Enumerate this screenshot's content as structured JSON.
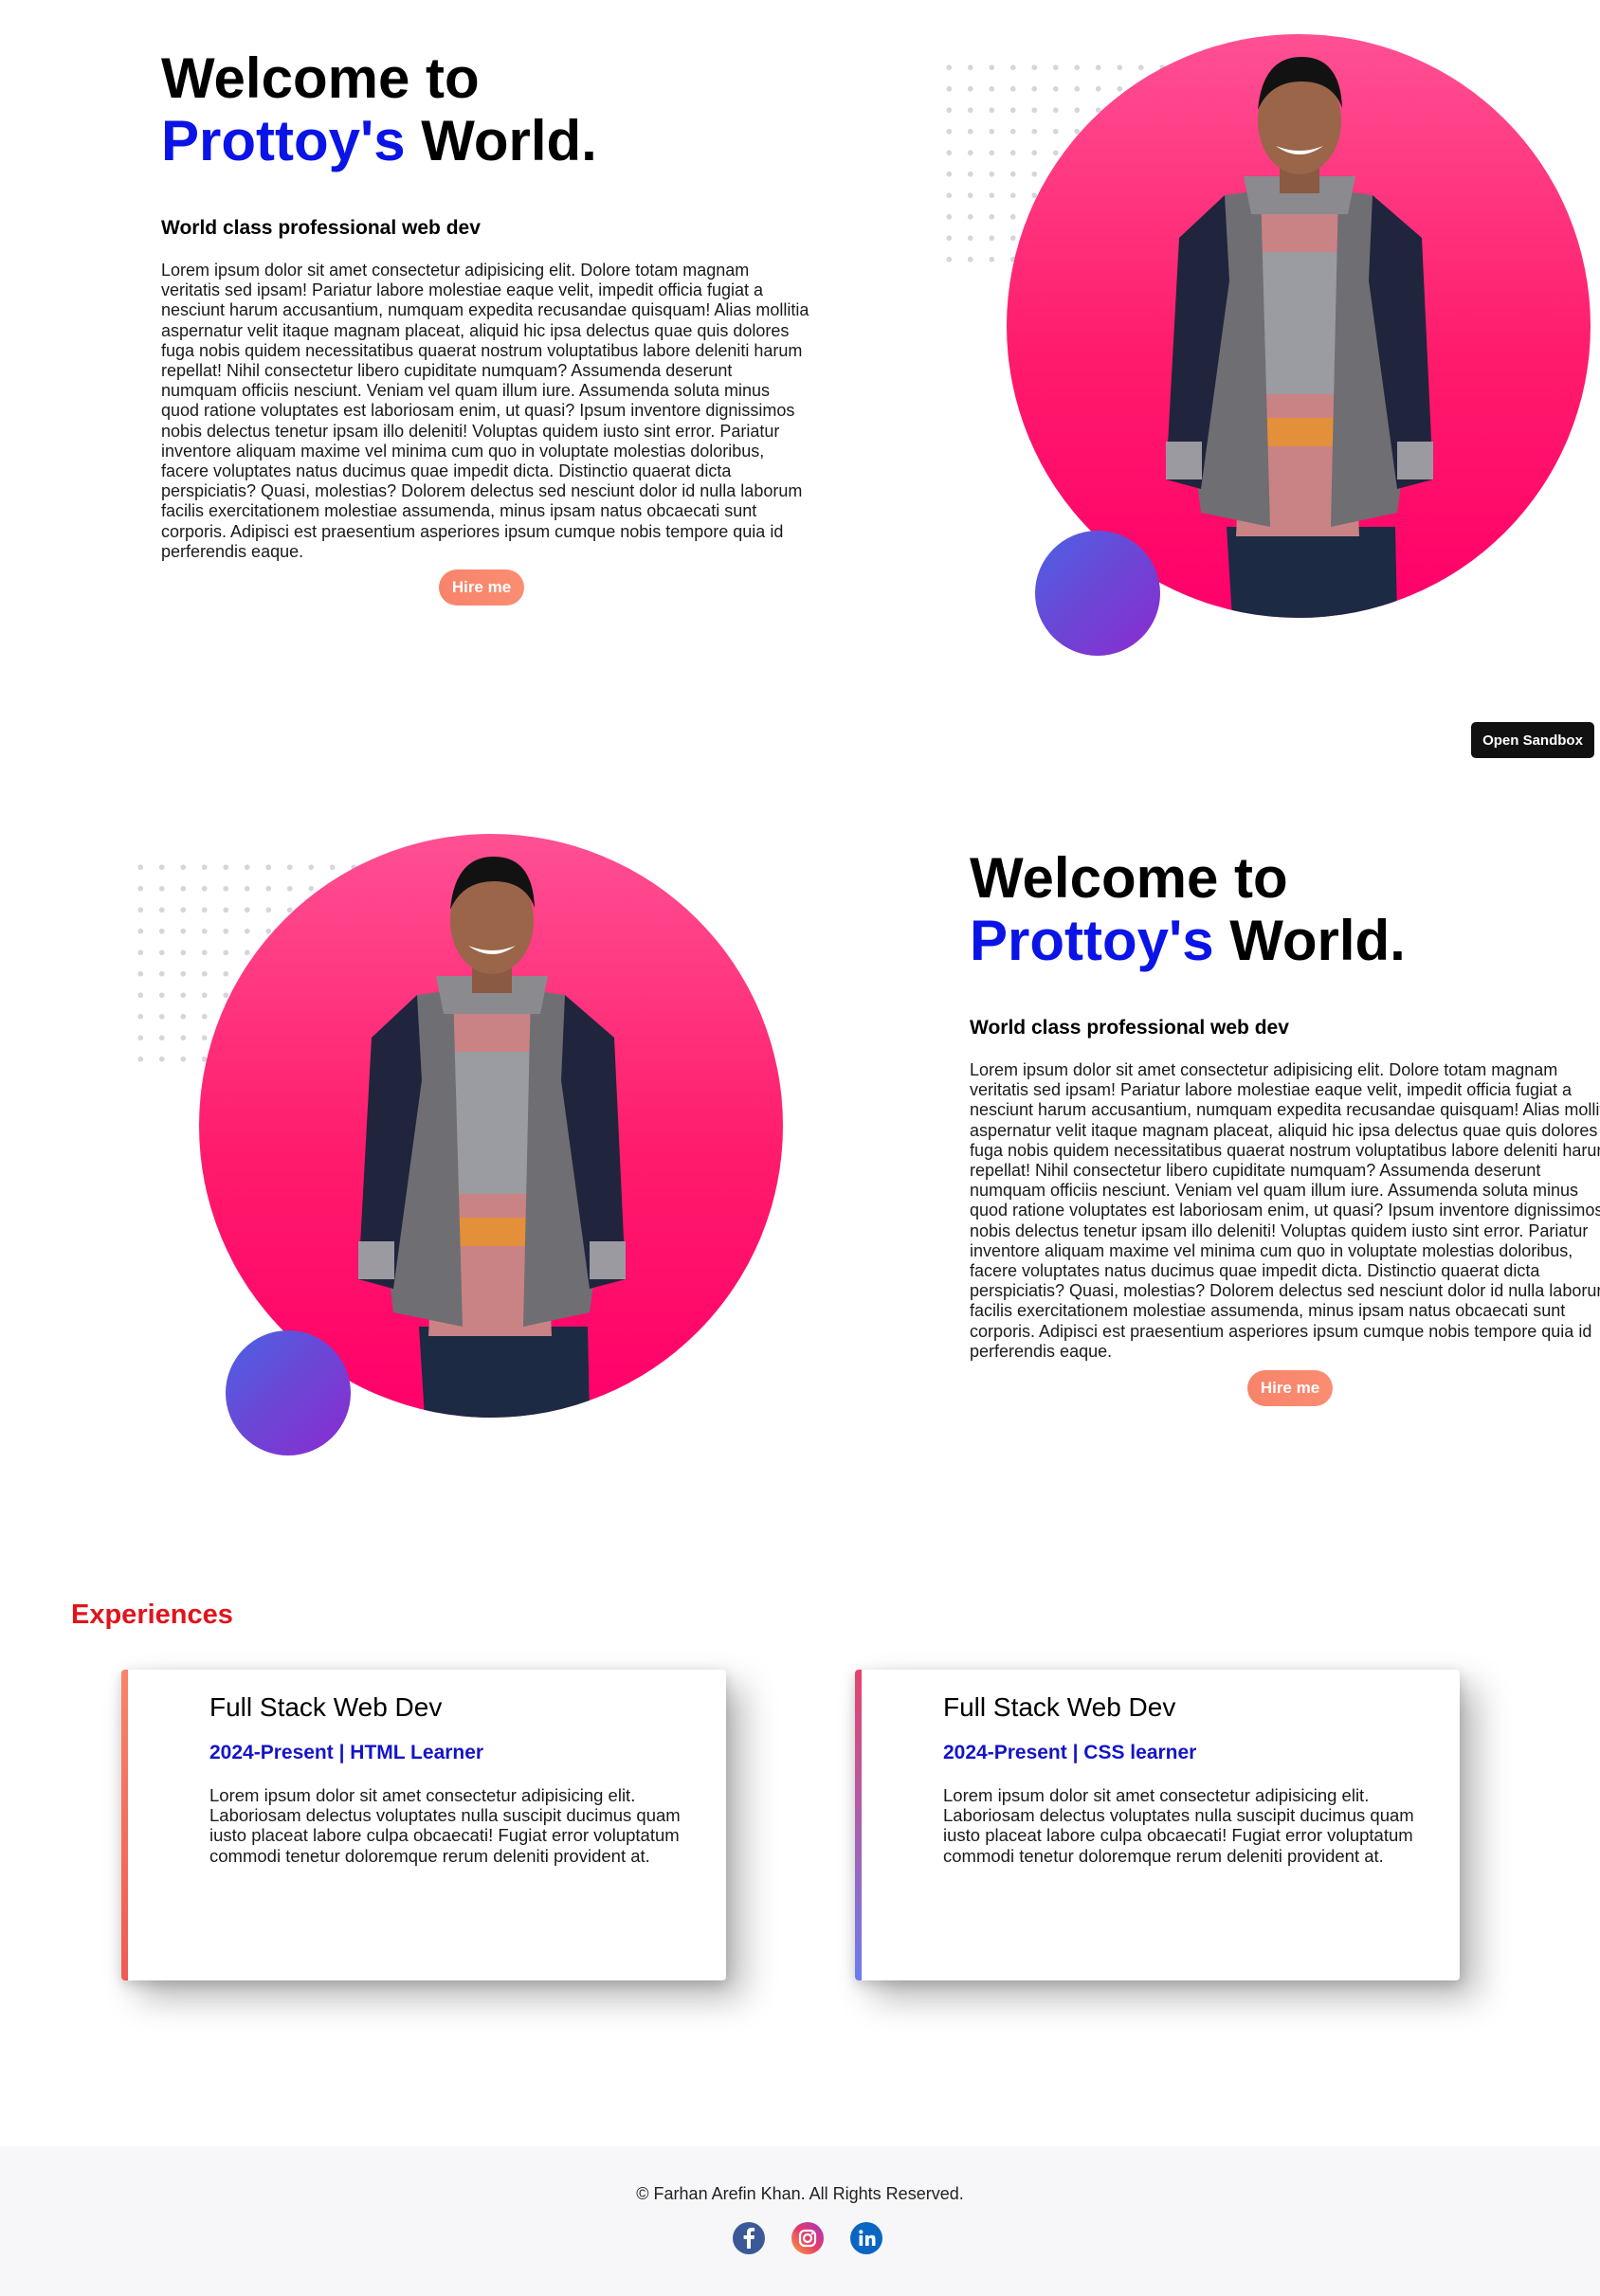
{
  "hero": {
    "title_line1": "Welcome to",
    "title_name": "Prottoy's",
    "title_rest": " World.",
    "subtitle": "World class professional web dev",
    "body": "Lorem ipsum dolor sit amet consectetur adipisicing elit. Dolore totam magnam veritatis sed ipsam! Pariatur labore molestiae eaque velit, impedit officia fugiat a nesciunt harum accusantium, numquam expedita recusandae quisquam! Alias mollitia aspernatur velit itaque magnam placeat, aliquid hic ipsa delectus quae quis dolores fuga nobis quidem necessitatibus quaerat nostrum voluptatibus labore deleniti harum repellat! Nihil consectetur libero cupiditate numquam? Assumenda deserunt numquam officiis nesciunt. Veniam vel quam illum iure. Assumenda soluta minus quod ratione voluptates est laboriosam enim, ut quasi? Ipsum inventore dignissimos nobis delectus tenetur ipsam illo deleniti! Voluptas quidem iusto sint error. Pariatur inventore aliquam maxime vel minima cum quo in voluptate molestias doloribus, facere voluptates natus ducimus quae impedit dicta. Distinctio quaerat dicta perspiciatis? Quasi, molestias? Dolorem delectus sed nesciunt dolor id nulla laborum facilis exercitationem molestiae assumenda, minus ipsam natus obcaecati sunt corporis. Adipisci est praesentium asperiores ipsum cumque nobis tempore quia id perferendis eaque.",
    "hire_label": "Hire me"
  },
  "sandbox": {
    "label": "Open Sandbox"
  },
  "experiences": {
    "heading": "Experiences",
    "items": [
      {
        "role": "Full Stack Web Dev",
        "period": "2024-Present | HTML Learner",
        "desc": "Lorem ipsum dolor sit amet consectetur adipisicing elit. Laboriosam delectus voluptates nulla suscipit ducimus quam iusto placeat labore culpa obcaecati! Fugiat error voluptatum commodi tenetur doloremque rerum deleniti provident at.",
        "accent_top": "#f7846a",
        "accent_bottom": "#ef5a52"
      },
      {
        "role": "Full Stack Web Dev",
        "period": "2024-Present | CSS learner",
        "desc": "Lorem ipsum dolor sit amet consectetur adipisicing elit. Laboriosam delectus voluptates nulla suscipit ducimus quam iusto placeat labore culpa obcaecati! Fugiat error voluptatum commodi tenetur doloremque rerum deleniti provident at.",
        "accent_top": "#e8436a",
        "accent_bottom": "#6a7cf0"
      }
    ]
  },
  "footer": {
    "copyright": "© Farhan Arefin Khan. All Rights Reserved.",
    "social": [
      {
        "icon": "facebook-icon",
        "color": "#3b5998"
      },
      {
        "icon": "instagram-icon",
        "color": "#d6249f"
      },
      {
        "icon": "linkedin-icon",
        "color": "#0a66c2"
      }
    ]
  },
  "colors": {
    "name_accent": "#0b14e6",
    "heading_red": "#e0141c",
    "pink": "#ff1b6b",
    "purple": "#6a48d6"
  }
}
